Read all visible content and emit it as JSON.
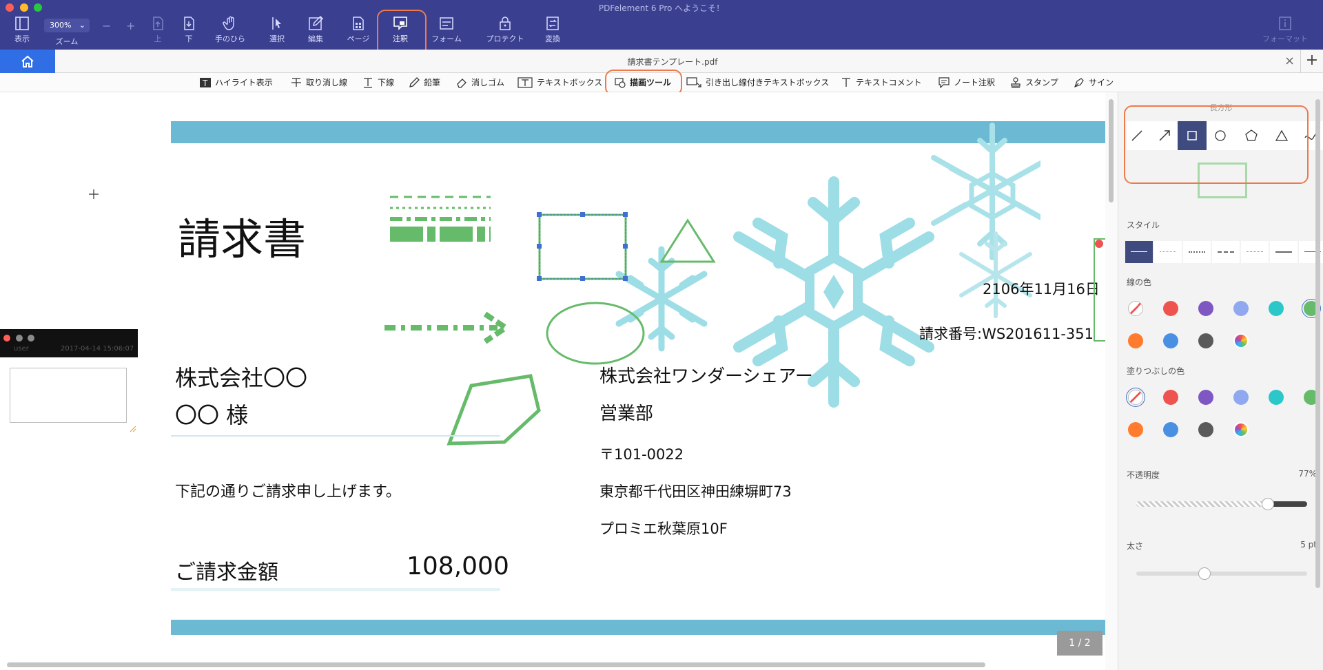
{
  "app_title": "PDFelement 6 Pro へようこそ！",
  "toolbar": {
    "view": "表示",
    "zoom_value": "300%",
    "zoom_label": "ズーム",
    "zoom_minus": "−",
    "zoom_plus": "+",
    "prev": "上",
    "next": "下",
    "hand": "手のひら",
    "select": "選択",
    "edit": "編集",
    "page": "ページ",
    "annotate": "注釈",
    "form": "フォーム",
    "protect": "プロテクト",
    "convert": "変換",
    "format": "フォーマット"
  },
  "tab": {
    "title": "請求書テンプレート.pdf",
    "close": "×",
    "add": "+"
  },
  "annotation_tools": [
    "ハイライト表示",
    "取り消し線",
    "下線",
    "鉛筆",
    "消しゴム",
    "テキストボックス",
    "描画ツール",
    "引き出し線付きテキストボックス",
    "テキストコメント",
    "ノート注釈",
    "スタンプ",
    "サイン"
  ],
  "note": {
    "user": "user",
    "timestamp": "2017-04-14 15:06:07"
  },
  "document": {
    "title": "請求書",
    "date": "2106年11月16日",
    "invoice_no": "請求番号:WS201611-351",
    "client_company": "株式会社〇〇",
    "client_name": "〇〇 様",
    "message": "下記の通りご請求申し上げます。",
    "amount_label": "ご請求金額",
    "amount_value": "108,000",
    "sender_company": "株式会社ワンダーシェアー",
    "sender_dept": "営業部",
    "postal": "〒101-0022",
    "address1": "東京都千代田区神田練塀町73",
    "address2": "プロミエ秋葉原10F",
    "page_indicator": "1 / 2"
  },
  "right_panel": {
    "shape_title": "長方形",
    "style_label": "スタイル",
    "line_color_label": "線の色",
    "fill_color_label": "塗りつぶしの色",
    "opacity_label": "不透明度",
    "opacity_value": "77%",
    "opacity": 0.77,
    "thickness_label": "太さ",
    "thickness_value": "5 pt",
    "line_colors": [
      "none",
      "#ef5350",
      "#7e57c2",
      "#90a8f0",
      "#2cc7c9",
      "#66bb6a",
      "#ff7b2e",
      "#4a90e2",
      "#5a5a5a",
      "rainbow"
    ],
    "fill_colors": [
      "none",
      "#ef5350",
      "#7e57c2",
      "#90a8f0",
      "#2cc7c9",
      "#66bb6a",
      "#ff7b2e",
      "#4a90e2",
      "#5a5a5a",
      "rainbow"
    ]
  },
  "colors": {
    "toolbar_bg": "#3a3f8f",
    "accent_blue": "#2f6ee5",
    "highlight_orange": "#ee7a4b",
    "shape_green": "#66bb6a",
    "band_blue": "#6bb9d2",
    "snow_blue": "#9ddde6"
  }
}
